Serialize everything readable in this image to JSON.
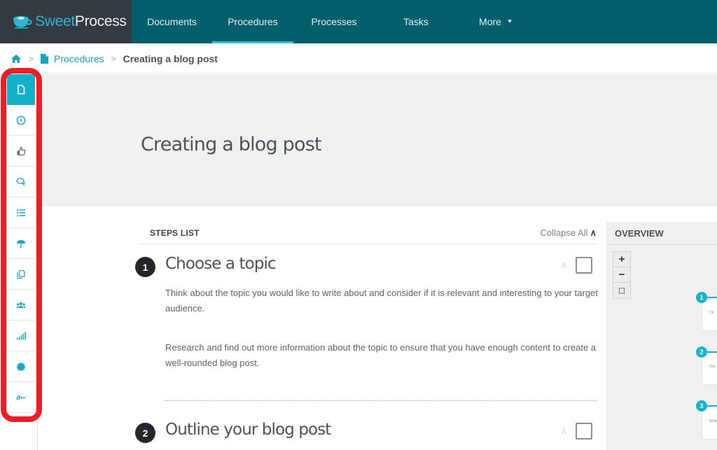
{
  "app": {
    "logo_light": "Sweet",
    "logo_bold": "Process",
    "nav": [
      {
        "label": "Documents",
        "active": false
      },
      {
        "label": "Procedures",
        "active": true
      },
      {
        "label": "Processes",
        "active": false
      },
      {
        "label": "Tasks",
        "active": false
      },
      {
        "label": "More",
        "active": false
      }
    ]
  },
  "breadcrumb": {
    "home_icon": "home-icon",
    "section_icon": "document-icon",
    "section": "Procedures",
    "current": "Creating a blog post"
  },
  "rail": {
    "items": [
      {
        "icon": "document-icon",
        "active": true
      },
      {
        "icon": "clock-icon",
        "active": false
      },
      {
        "icon": "thumbs-up-icon",
        "active": false
      },
      {
        "icon": "comments-icon",
        "active": false
      },
      {
        "icon": "checklist-icon",
        "active": false
      },
      {
        "icon": "umbrella-icon",
        "active": false
      },
      {
        "icon": "copy-icon",
        "active": false
      },
      {
        "icon": "users-icon",
        "active": false
      },
      {
        "icon": "signal-bars-icon",
        "active": false
      },
      {
        "icon": "badge-icon",
        "active": false
      },
      {
        "icon": "signature-icon",
        "active": false
      }
    ],
    "highlight_color": "#ee1c25"
  },
  "page": {
    "title": "Creating a blog post"
  },
  "steps": {
    "header": "STEPS LIST",
    "collapse_all": "Collapse All",
    "items": [
      {
        "number": "1",
        "title": "Choose a topic",
        "paragraphs": [
          "Think about the topic you would like to write about and consider if it is relevant and interesting to your target audience.",
          "Research and find out more information about the topic to ensure that you have enough content to create a well-rounded blog post."
        ],
        "checked": false
      },
      {
        "number": "2",
        "title": "Outline your blog post",
        "paragraphs": [],
        "checked": false
      }
    ]
  },
  "overview": {
    "title": "OVERVIEW",
    "zoom_in": "+",
    "zoom_out": "−",
    "fit": "⛶",
    "nodes": [
      {
        "number": "1",
        "label": "Ch"
      },
      {
        "number": "2",
        "label": "Out"
      },
      {
        "number": "3",
        "label": "Write"
      }
    ]
  },
  "colors": {
    "nav_bg": "#005f6b",
    "logo_bg": "#333a42",
    "accent": "#14b1cb"
  }
}
